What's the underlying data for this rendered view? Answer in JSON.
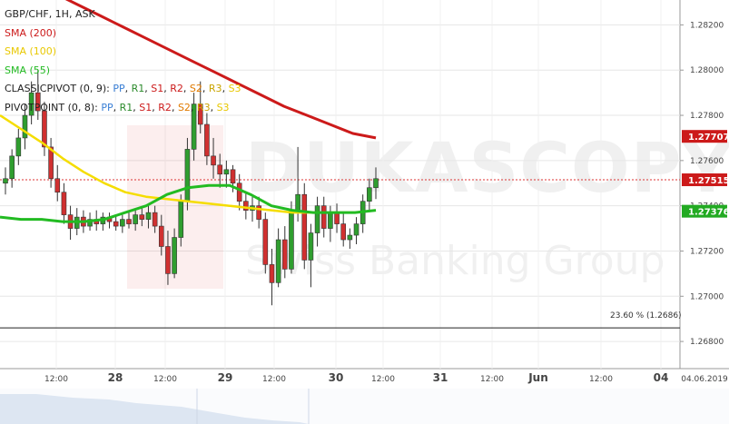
{
  "legend": {
    "symbol_line": "GBP/CHF, 1H, ASK",
    "sma200": {
      "label": "SMA (200)",
      "color": "#cc1a1a"
    },
    "sma100": {
      "label": "SMA (100)",
      "color": "#f5dd00"
    },
    "sma55": {
      "label": "SMA (55)",
      "color": "#22bb22"
    },
    "classic_pivot": {
      "prefix": "CLASSICPIVOT (0, 9):",
      "names": [
        "PP",
        "R1",
        "S1",
        "R2",
        "S2",
        "R3",
        "S3"
      ]
    },
    "pivot_point": {
      "prefix": "PIVOTPOINT (0, 8):",
      "names": [
        "PP",
        "R1",
        "S1",
        "R2",
        "S2",
        "R3",
        "S3"
      ]
    },
    "name_colors": [
      "#3a7fd5",
      "#2b8a2b",
      "#cc1a1a",
      "#cc1a1a",
      "#e07a00",
      "#c9a400",
      "#e8c800"
    ]
  },
  "watermark": {
    "title": "DUKASCOPY",
    "subtitle": "Swiss Banking Group"
  },
  "fib_label": "23.60 % (1.2686)",
  "price_labels": [
    {
      "text": "1.27707",
      "value": 1.27707,
      "color": "#cc1a1a"
    },
    {
      "text": "1.27515",
      "value": 1.27515,
      "color": "#cc1a1a"
    },
    {
      "text": "1.27376",
      "value": 1.27376,
      "color": "#22aa22"
    }
  ],
  "chart_data": {
    "type": "candlestick",
    "title": "GBP/CHF, 1H, ASK",
    "y_ticks": [
      "1.26800",
      "1.27000",
      "1.27200",
      "1.27400",
      "1.27600",
      "1.27800",
      "1.28000",
      "1.28200"
    ],
    "ylim": [
      1.2668,
      1.2831
    ],
    "x_ticks": [
      "12:00",
      "28",
      "12:00",
      "29",
      "12:00",
      "30",
      "12:00",
      "31",
      "12:00",
      "Jun",
      "12:00",
      "04",
      "04.06.2019"
    ],
    "current_price": 1.27515,
    "fib_level": {
      "label": "23.60 %",
      "value": 1.2686
    },
    "candles": [
      {
        "o": 1.275,
        "h": 1.2757,
        "l": 1.2745,
        "c": 1.2752
      },
      {
        "o": 1.2752,
        "h": 1.2765,
        "l": 1.2748,
        "c": 1.2762
      },
      {
        "o": 1.2762,
        "h": 1.2774,
        "l": 1.2758,
        "c": 1.277
      },
      {
        "o": 1.277,
        "h": 1.2785,
        "l": 1.2765,
        "c": 1.278
      },
      {
        "o": 1.278,
        "h": 1.2795,
        "l": 1.2776,
        "c": 1.279
      },
      {
        "o": 1.279,
        "h": 1.28,
        "l": 1.2778,
        "c": 1.2782
      },
      {
        "o": 1.2782,
        "h": 1.2786,
        "l": 1.2762,
        "c": 1.2766
      },
      {
        "o": 1.2766,
        "h": 1.277,
        "l": 1.2748,
        "c": 1.2752
      },
      {
        "o": 1.2752,
        "h": 1.2758,
        "l": 1.2742,
        "c": 1.2746
      },
      {
        "o": 1.2746,
        "h": 1.275,
        "l": 1.2732,
        "c": 1.2736
      },
      {
        "o": 1.2736,
        "h": 1.274,
        "l": 1.2725,
        "c": 1.273
      },
      {
        "o": 1.273,
        "h": 1.2739,
        "l": 1.2727,
        "c": 1.2735
      },
      {
        "o": 1.2735,
        "h": 1.2738,
        "l": 1.2728,
        "c": 1.2731
      },
      {
        "o": 1.2731,
        "h": 1.2737,
        "l": 1.2729,
        "c": 1.2734
      },
      {
        "o": 1.2734,
        "h": 1.2738,
        "l": 1.2729,
        "c": 1.2732
      },
      {
        "o": 1.2732,
        "h": 1.2737,
        "l": 1.2729,
        "c": 1.2735
      },
      {
        "o": 1.2735,
        "h": 1.2737,
        "l": 1.273,
        "c": 1.2733
      },
      {
        "o": 1.2733,
        "h": 1.2736,
        "l": 1.2729,
        "c": 1.2731
      },
      {
        "o": 1.2731,
        "h": 1.2736,
        "l": 1.2728,
        "c": 1.2734
      },
      {
        "o": 1.2734,
        "h": 1.2737,
        "l": 1.273,
        "c": 1.2732
      },
      {
        "o": 1.2732,
        "h": 1.2738,
        "l": 1.2729,
        "c": 1.2736
      },
      {
        "o": 1.2736,
        "h": 1.2739,
        "l": 1.2731,
        "c": 1.2734
      },
      {
        "o": 1.2734,
        "h": 1.274,
        "l": 1.273,
        "c": 1.2737
      },
      {
        "o": 1.2737,
        "h": 1.274,
        "l": 1.2728,
        "c": 1.2731
      },
      {
        "o": 1.2731,
        "h": 1.2736,
        "l": 1.2718,
        "c": 1.2722
      },
      {
        "o": 1.2722,
        "h": 1.2729,
        "l": 1.2705,
        "c": 1.271
      },
      {
        "o": 1.271,
        "h": 1.273,
        "l": 1.2708,
        "c": 1.2726
      },
      {
        "o": 1.2726,
        "h": 1.2745,
        "l": 1.2722,
        "c": 1.2742
      },
      {
        "o": 1.2742,
        "h": 1.277,
        "l": 1.2738,
        "c": 1.2765
      },
      {
        "o": 1.2765,
        "h": 1.279,
        "l": 1.276,
        "c": 1.2785
      },
      {
        "o": 1.2785,
        "h": 1.2795,
        "l": 1.2772,
        "c": 1.2776
      },
      {
        "o": 1.2776,
        "h": 1.2781,
        "l": 1.2758,
        "c": 1.2762
      },
      {
        "o": 1.2762,
        "h": 1.277,
        "l": 1.2752,
        "c": 1.2758
      },
      {
        "o": 1.2758,
        "h": 1.2763,
        "l": 1.2748,
        "c": 1.2754
      },
      {
        "o": 1.2754,
        "h": 1.276,
        "l": 1.2748,
        "c": 1.2756
      },
      {
        "o": 1.2756,
        "h": 1.2758,
        "l": 1.2746,
        "c": 1.275
      },
      {
        "o": 1.275,
        "h": 1.2754,
        "l": 1.2738,
        "c": 1.2742
      },
      {
        "o": 1.2742,
        "h": 1.2746,
        "l": 1.2734,
        "c": 1.2738
      },
      {
        "o": 1.2738,
        "h": 1.2744,
        "l": 1.2733,
        "c": 1.274
      },
      {
        "o": 1.274,
        "h": 1.2744,
        "l": 1.273,
        "c": 1.2734
      },
      {
        "o": 1.2734,
        "h": 1.2737,
        "l": 1.271,
        "c": 1.2714
      },
      {
        "o": 1.2714,
        "h": 1.2721,
        "l": 1.2696,
        "c": 1.2706
      },
      {
        "o": 1.2706,
        "h": 1.273,
        "l": 1.2704,
        "c": 1.2725
      },
      {
        "o": 1.2725,
        "h": 1.2731,
        "l": 1.2708,
        "c": 1.2712
      },
      {
        "o": 1.2712,
        "h": 1.2742,
        "l": 1.271,
        "c": 1.2738
      },
      {
        "o": 1.2738,
        "h": 1.2766,
        "l": 1.2733,
        "c": 1.2745
      },
      {
        "o": 1.2745,
        "h": 1.275,
        "l": 1.2712,
        "c": 1.2716
      },
      {
        "o": 1.2716,
        "h": 1.2732,
        "l": 1.2704,
        "c": 1.2728
      },
      {
        "o": 1.2728,
        "h": 1.2744,
        "l": 1.2722,
        "c": 1.274
      },
      {
        "o": 1.274,
        "h": 1.2744,
        "l": 1.2726,
        "c": 1.273
      },
      {
        "o": 1.273,
        "h": 1.274,
        "l": 1.2724,
        "c": 1.2737
      },
      {
        "o": 1.2737,
        "h": 1.2741,
        "l": 1.2728,
        "c": 1.2732
      },
      {
        "o": 1.2732,
        "h": 1.2737,
        "l": 1.2722,
        "c": 1.2725
      },
      {
        "o": 1.2725,
        "h": 1.273,
        "l": 1.2721,
        "c": 1.2727
      },
      {
        "o": 1.2727,
        "h": 1.2735,
        "l": 1.2723,
        "c": 1.2732
      },
      {
        "o": 1.2732,
        "h": 1.2745,
        "l": 1.2728,
        "c": 1.2742
      },
      {
        "o": 1.2742,
        "h": 1.2752,
        "l": 1.2738,
        "c": 1.2748
      },
      {
        "o": 1.2748,
        "h": 1.2757,
        "l": 1.2743,
        "c": 1.2752
      }
    ],
    "sma200": [
      1.2834,
      1.2829,
      1.2824,
      1.2819,
      1.2814,
      1.2809,
      1.2804,
      1.2799,
      1.2794,
      1.2789,
      1.2784,
      1.278,
      1.2776,
      1.2772,
      1.277
    ],
    "sma100": [
      1.278,
      1.2774,
      1.2768,
      1.2761,
      1.2755,
      1.275,
      1.2746,
      1.2744,
      1.2743,
      1.2742,
      1.2741,
      1.274,
      1.2739,
      1.2738,
      1.2737,
      1.2737,
      1.2737,
      1.2737,
      1.2738
    ],
    "sma55": [
      1.2735,
      1.2734,
      1.2734,
      1.2733,
      1.2733,
      1.2734,
      1.2737,
      1.274,
      1.2745,
      1.2748,
      1.2749,
      1.2749,
      1.2745,
      1.274,
      1.2738,
      1.2737,
      1.2737,
      1.2737,
      1.2738
    ]
  }
}
